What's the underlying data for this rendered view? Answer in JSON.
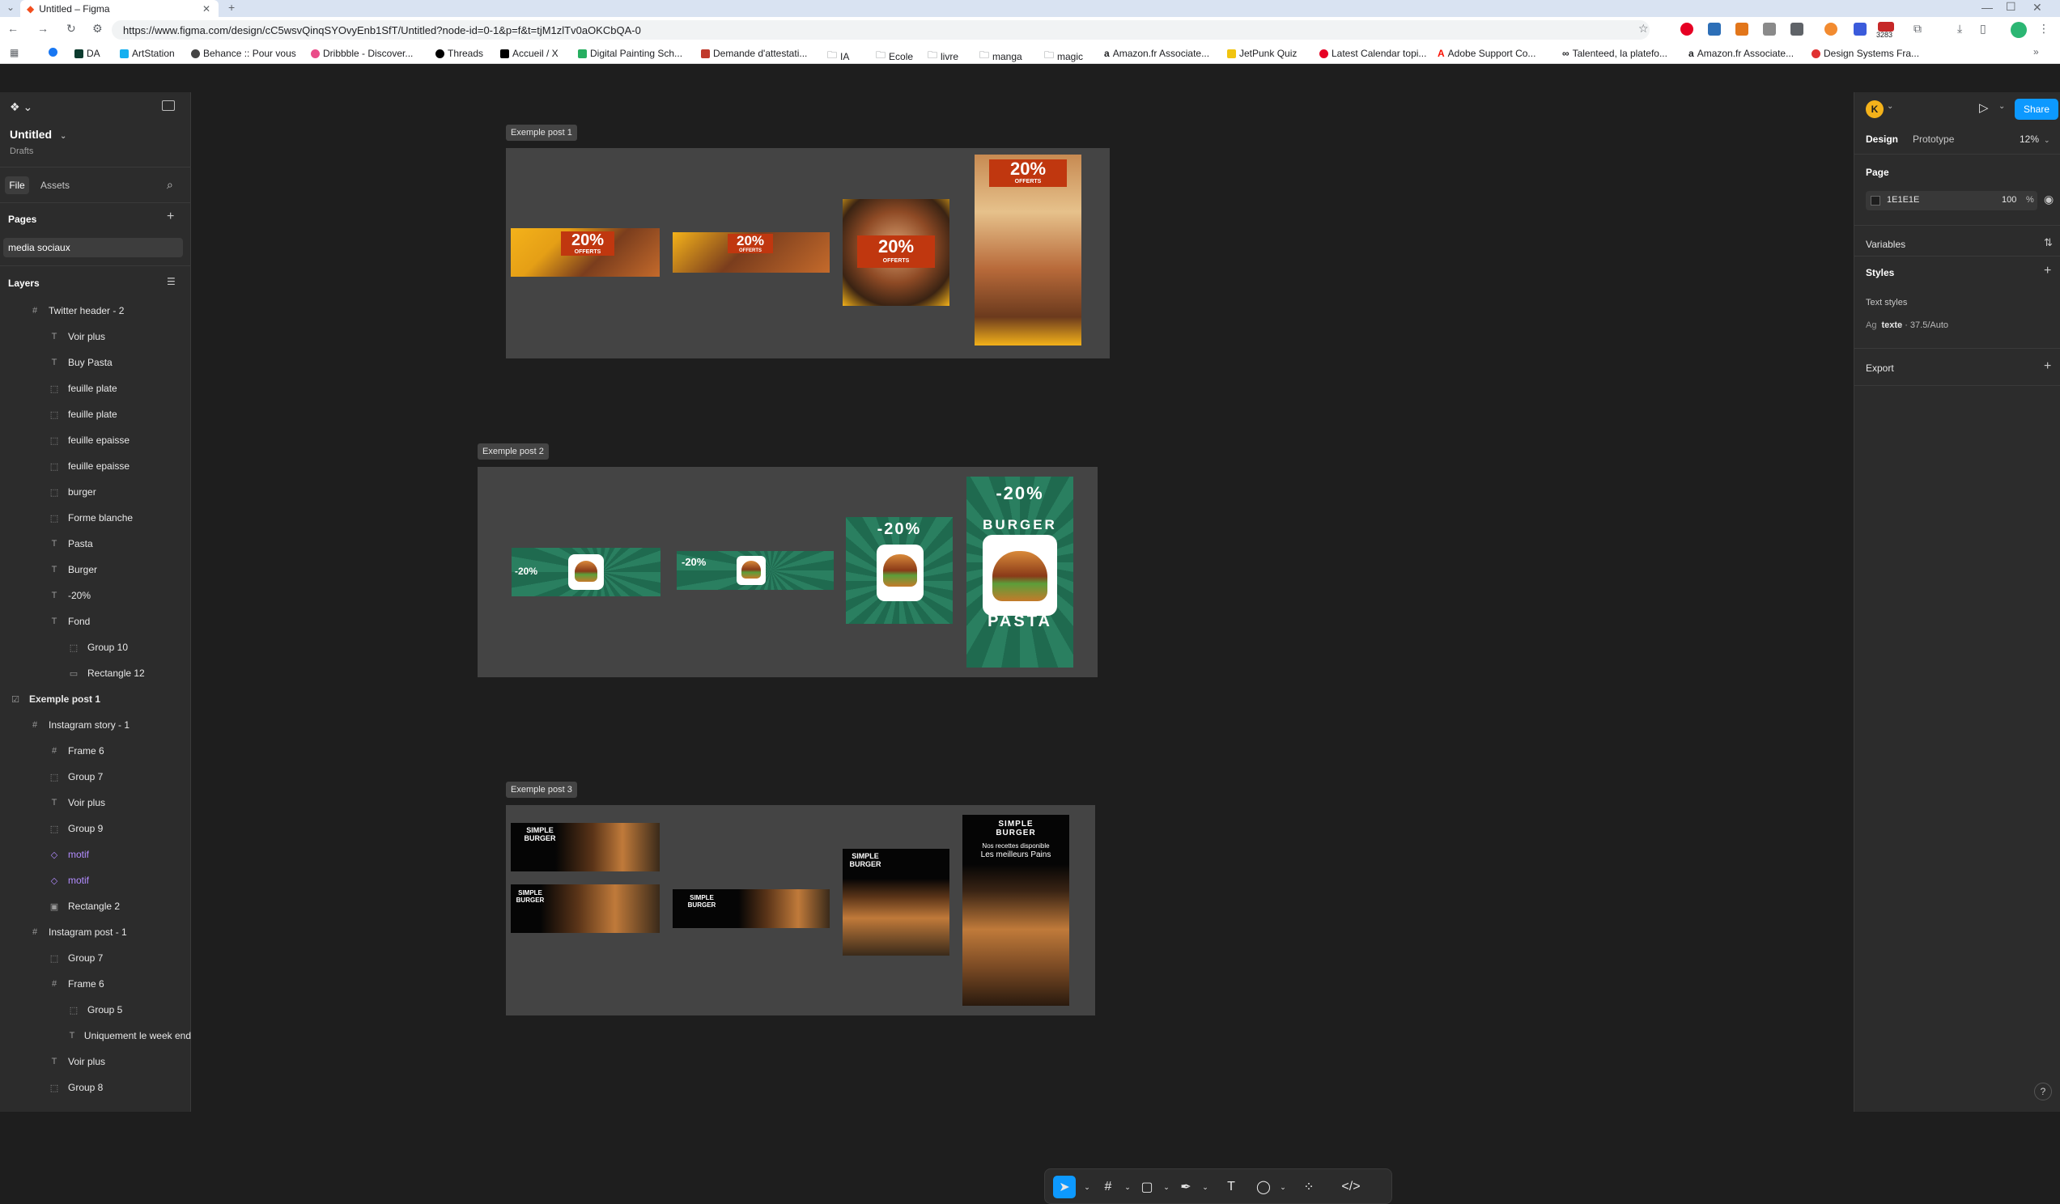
{
  "browser": {
    "tab_title": "Untitled – Figma",
    "url": "https://www.figma.com/design/cC5wsvQinqSYOvyEnb1SfT/Untitled?node-id=0-1&p=f&t=tjM1zlTv0aOKCbQA-0",
    "badge_count": "3283",
    "bookmarks": [
      "DA",
      "ArtStation",
      "Behance :: Pour vous",
      "Dribbble - Discover...",
      "Threads",
      "Accueil / X",
      "Digital Painting Sch...",
      "Demande d'attestati...",
      "IA",
      "Ecole",
      "livre",
      "manga",
      "magic",
      "Amazon.fr Associate...",
      "JetPunk Quiz",
      "Latest Calendar topi...",
      "Adobe Support Co...",
      "Talenteed, la platefo...",
      "Amazon.fr Associate...",
      "Design Systems Fra..."
    ]
  },
  "file": {
    "name": "Untitled",
    "location": "Drafts",
    "tab_file": "File",
    "tab_assets": "Assets"
  },
  "pages": {
    "title": "Pages",
    "items": [
      "media sociaux"
    ]
  },
  "layers": {
    "title": "Layers",
    "items": [
      {
        "label": "Twitter header - 2",
        "icon": "frame-icon",
        "depth": 1
      },
      {
        "label": "Voir plus",
        "icon": "text-icon",
        "depth": 2
      },
      {
        "label": "Buy Pasta",
        "icon": "text-icon",
        "depth": 2
      },
      {
        "label": "feuille plate",
        "icon": "group-icon",
        "depth": 2
      },
      {
        "label": "feuille plate",
        "icon": "group-icon",
        "depth": 2
      },
      {
        "label": "feuille epaisse",
        "icon": "group-icon",
        "depth": 2
      },
      {
        "label": "feuille epaisse",
        "icon": "group-icon",
        "depth": 2
      },
      {
        "label": "burger",
        "icon": "group-icon",
        "depth": 2
      },
      {
        "label": "Forme blanche",
        "icon": "group-icon",
        "depth": 2
      },
      {
        "label": "Pasta",
        "icon": "text-icon",
        "depth": 2
      },
      {
        "label": "Burger",
        "icon": "text-icon",
        "depth": 2
      },
      {
        "label": "-20%",
        "icon": "text-icon",
        "depth": 2
      },
      {
        "label": "Fond",
        "icon": "text-icon",
        "depth": 2
      },
      {
        "label": "Group 10",
        "icon": "group-icon",
        "depth": 3
      },
      {
        "label": "Rectangle 12",
        "icon": "rectangle-icon",
        "depth": 3
      },
      {
        "label": "Exemple post 1",
        "icon": "section-icon",
        "depth": 0
      },
      {
        "label": "Instagram story - 1",
        "icon": "frame-icon",
        "depth": 1
      },
      {
        "label": "Frame 6",
        "icon": "frame-icon",
        "depth": 2
      },
      {
        "label": "Group 7",
        "icon": "group-icon",
        "depth": 2
      },
      {
        "label": "Voir plus",
        "icon": "text-icon",
        "depth": 2
      },
      {
        "label": "Group 9",
        "icon": "group-icon",
        "depth": 2
      },
      {
        "label": "motif",
        "icon": "component-icon",
        "depth": 2
      },
      {
        "label": "motif",
        "icon": "component-icon",
        "depth": 2
      },
      {
        "label": "Rectangle 2",
        "icon": "image-icon",
        "depth": 2
      },
      {
        "label": "Instagram post - 1",
        "icon": "frame-icon",
        "depth": 1
      },
      {
        "label": "Group 7",
        "icon": "group-icon",
        "depth": 2
      },
      {
        "label": "Frame 6",
        "icon": "frame-icon",
        "depth": 2
      },
      {
        "label": "Group 5",
        "icon": "group-icon",
        "depth": 3
      },
      {
        "label": "Uniquement le week end",
        "icon": "text-icon",
        "depth": 3
      },
      {
        "label": "Voir plus",
        "icon": "text-icon",
        "depth": 2
      },
      {
        "label": "Group 8",
        "icon": "group-icon",
        "depth": 2
      }
    ]
  },
  "right_panel": {
    "avatar": "K",
    "share": "Share",
    "tab_design": "Design",
    "tab_prototype": "Prototype",
    "zoom": "12%",
    "page_title": "Page",
    "page_color": "1E1E1E",
    "page_opacity": "100",
    "percent": "%",
    "variables": "Variables",
    "styles": "Styles",
    "text_styles": "Text styles",
    "text_style_prefix": "Ag",
    "text_style_name": "texte",
    "text_style_spec": " · 37.5/Auto",
    "export": "Export"
  },
  "canvas": {
    "section1": "Exemple post 1",
    "section2": "Exemple post 2",
    "section3": "Exemple post 3",
    "promo_1": "20%",
    "promo_1_sub": "OFFERTS",
    "promo_2": "-20%",
    "promo_2_burger": "BURGER",
    "promo_2_pasta": "PASTA",
    "promo_3_title": "SIMPLE",
    "promo_3_title2": "BURGER",
    "promo_3_sub": "Nos recettes disponible",
    "promo_3_sub2": "Les meilleurs Pains"
  },
  "colors": {
    "accent": "#0d99ff",
    "promo_red": "#c0370f",
    "promo_green": "#1f6a4f",
    "promo_yellow": "#f4b21a"
  }
}
